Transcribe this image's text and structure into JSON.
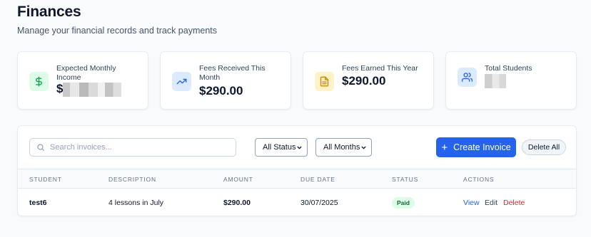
{
  "header": {
    "title": "Finances",
    "subtitle": "Manage your financial records and track payments"
  },
  "stats": [
    {
      "label": "Expected Monthly Income",
      "value": "$",
      "icon": "dollar-icon",
      "color": "#16a34a",
      "bg": "#dcfce7",
      "redacted": true
    },
    {
      "label": "Fees Received This Month",
      "value": "$290.00",
      "icon": "trending-up-icon",
      "color": "#2563eb",
      "bg": "#dbeafe"
    },
    {
      "label": "Fees Earned This Year",
      "value": "$290.00",
      "icon": "document-icon",
      "color": "#ca8a04",
      "bg": "#fef3c7"
    },
    {
      "label": "Total Students",
      "value": "",
      "icon": "users-icon",
      "color": "#2563eb",
      "bg": "#dbeafe",
      "redacted": true
    }
  ],
  "toolbar": {
    "search_placeholder": "Search invoices...",
    "status_filter": "All Status",
    "month_filter": "All Months",
    "create_label": "Create Invoice",
    "delete_all_label": "Delete All"
  },
  "table": {
    "columns": [
      "STUDENT",
      "DESCRIPTION",
      "AMOUNT",
      "DUE DATE",
      "STATUS",
      "ACTIONS"
    ],
    "rows": [
      {
        "student": "test6",
        "description": "4 lessons in July",
        "amount": "$290.00",
        "due_date": "30/07/2025",
        "status": "Paid",
        "actions": {
          "view": "View",
          "edit": "Edit",
          "delete": "Delete"
        }
      }
    ]
  },
  "colors": {
    "primary": "#2563eb",
    "danger": "#dc2626",
    "paid_bg": "#dcfce7",
    "paid_text": "#166534"
  }
}
